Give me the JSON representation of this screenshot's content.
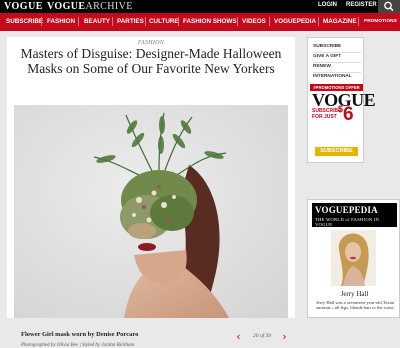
{
  "topbar": {
    "logo": "VOGUE",
    "archive_prefix": "VOGUE",
    "archive_suffix": "ARCHIVE",
    "login": "LOGIN",
    "register": "REGISTER"
  },
  "nav": {
    "items": [
      "SUBSCRIBE",
      "FASHION",
      "BEAUTY",
      "PARTIES",
      "CULTURE",
      "FASHION SHOWS",
      "VIDEOS",
      "VOGUEPEDIA",
      "MAGAZINE",
      "PROMOTIONS"
    ]
  },
  "article": {
    "category": "FASHION",
    "title": "Masters of Disguise: Designer-Made Halloween Masks on Some of Our Favorite New Yorkers",
    "caption": "Flower Girl mask worn by Denise Porcaro",
    "credit": "Photographed by Olivia Bee | Styled by Jordan Bickham",
    "pager": {
      "current": "20",
      "of_label": "of",
      "total": "39"
    }
  },
  "sidebar": {
    "links": [
      "SUBSCRIBE",
      "GIVE A GIFT",
      "RENEW",
      "INTERNATIONAL"
    ],
    "promo_banner": "#PROMOTIONS OFFER",
    "promo_logo": "VOGUE",
    "promo_line1": "SUBSCRIBE",
    "promo_line2": "FOR JUST",
    "promo_price": "6",
    "promo_currency": "$",
    "subscribe_button": "SUBSCRIBE",
    "voguepedia_title": "VOGUEPEDIA",
    "voguepedia_tagline": "THE WORLD of FASHION IN VOGUE",
    "person_name": "Jerry Hall",
    "person_desc": "Jerry Hall was a seventeen-year-old Texan amazon—all legs, blonde hair to the waist,"
  },
  "colors": {
    "brand_red": "#c3091a",
    "subscribe_yellow": "#e7b400"
  }
}
